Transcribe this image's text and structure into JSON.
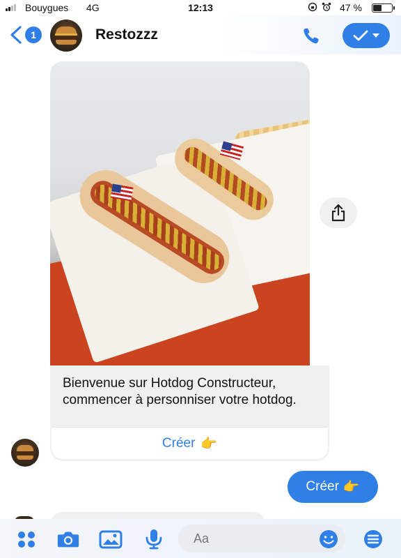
{
  "status": {
    "carrier": "Bouygues",
    "network": "4G",
    "time": "12:13",
    "battery_pct": "47 %",
    "battery_level": 0.47
  },
  "header": {
    "back_count": "1",
    "title": "Restozzz",
    "accent": "#2f7fe6"
  },
  "messages": {
    "received_text": "Bienvenue sur Hotdog Constructeur, commencer à personniser votre hotdog.",
    "card_button_label": "Créer",
    "card_button_emoji": "👉",
    "sent_text": "Créer",
    "sent_emoji": "👉"
  },
  "composer": {
    "placeholder": "Aa"
  },
  "icons": {
    "status": [
      "signal-icon",
      "lock-rotation-icon",
      "alarm-icon",
      "battery-icon"
    ],
    "header": [
      "back-icon",
      "phone-icon",
      "check-icon",
      "chevron-down-icon"
    ],
    "composer": [
      "apps-icon",
      "camera-icon",
      "gallery-icon",
      "microphone-icon",
      "emoji-icon",
      "menu-icon"
    ],
    "chat": [
      "share-icon"
    ]
  }
}
